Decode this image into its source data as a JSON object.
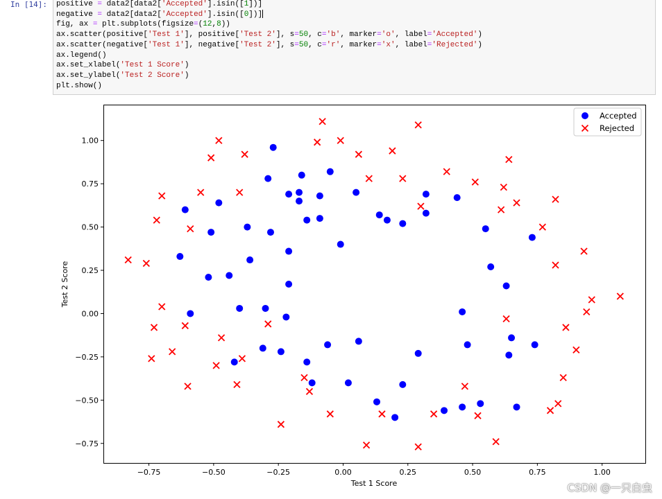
{
  "cell": {
    "prompt": "In  [14]:",
    "lines": [
      [
        [
          "positive ",
          ""
        ],
        [
          "=",
          "op"
        ],
        [
          " data2[data2[",
          ""
        ],
        [
          "'Accepted'",
          "str"
        ],
        [
          "].isin([",
          ""
        ],
        [
          "1",
          "num"
        ],
        [
          "])]",
          ""
        ]
      ],
      [
        [
          "negative ",
          ""
        ],
        [
          "=",
          "op"
        ],
        [
          " data2[data2[",
          ""
        ],
        [
          "'Accepted'",
          "str"
        ],
        [
          "].isin([",
          ""
        ],
        [
          "0",
          "num"
        ],
        [
          "])]",
          ""
        ]
      ],
      [
        [
          "fig, ax ",
          ""
        ],
        [
          "=",
          "op"
        ],
        [
          " plt.subplots(figsize",
          ""
        ],
        [
          "=",
          "op"
        ],
        [
          "(",
          ""
        ],
        [
          "12",
          "num"
        ],
        [
          ",",
          ""
        ],
        [
          "8",
          "num"
        ],
        [
          "))",
          ""
        ]
      ],
      [
        [
          "ax.scatter(positive[",
          ""
        ],
        [
          "'Test 1'",
          "str"
        ],
        [
          "], positive[",
          ""
        ],
        [
          "'Test 2'",
          "str"
        ],
        [
          "], s",
          ""
        ],
        [
          "=",
          "op"
        ],
        [
          "50",
          "num"
        ],
        [
          ", c",
          ""
        ],
        [
          "=",
          "op"
        ],
        [
          "'b'",
          "str"
        ],
        [
          ", marker",
          ""
        ],
        [
          "=",
          "op"
        ],
        [
          "'o'",
          "str"
        ],
        [
          ", label",
          ""
        ],
        [
          "=",
          "op"
        ],
        [
          "'Accepted'",
          "str"
        ],
        [
          ")",
          ""
        ]
      ],
      [
        [
          "ax.scatter(negative[",
          ""
        ],
        [
          "'Test 1'",
          "str"
        ],
        [
          "], negative[",
          ""
        ],
        [
          "'Test 2'",
          "str"
        ],
        [
          "], s",
          ""
        ],
        [
          "=",
          "op"
        ],
        [
          "50",
          "num"
        ],
        [
          ", c",
          ""
        ],
        [
          "=",
          "op"
        ],
        [
          "'r'",
          "str"
        ],
        [
          ", marker",
          ""
        ],
        [
          "=",
          "op"
        ],
        [
          "'x'",
          "str"
        ],
        [
          ", label",
          ""
        ],
        [
          "=",
          "op"
        ],
        [
          "'Rejected'",
          "str"
        ],
        [
          ")",
          ""
        ]
      ],
      [
        [
          "ax.legend()",
          ""
        ]
      ],
      [
        [
          "ax.set_xlabel(",
          ""
        ],
        [
          "'Test 1 Score'",
          "str"
        ],
        [
          ")",
          ""
        ]
      ],
      [
        [
          "ax.set_ylabel(",
          ""
        ],
        [
          "'Test 2 Score'",
          "str"
        ],
        [
          ")",
          ""
        ]
      ],
      [
        [
          "plt.show()",
          ""
        ]
      ]
    ]
  },
  "chart_data": {
    "type": "scatter",
    "xlabel": "Test 1 Score",
    "ylabel": "Test 2 Score",
    "xlim": [
      -0.923,
      1.167
    ],
    "ylim": [
      -0.863,
      1.203
    ],
    "xticks": [
      -0.75,
      -0.5,
      -0.25,
      0.0,
      0.25,
      0.5,
      0.75,
      1.0
    ],
    "xtick_labels": [
      "−0.75",
      "−0.50",
      "−0.25",
      "0.00",
      "0.25",
      "0.50",
      "0.75",
      "1.00"
    ],
    "yticks": [
      -0.75,
      -0.5,
      -0.25,
      0.0,
      0.25,
      0.5,
      0.75,
      1.0
    ],
    "ytick_labels": [
      "−0.75",
      "−0.50",
      "−0.25",
      "0.00",
      "0.25",
      "0.50",
      "0.75",
      "1.00"
    ],
    "grid": false,
    "legend_position": "top-right",
    "series": [
      {
        "name": "Accepted",
        "marker": "o",
        "color": "#0000ff",
        "points": [
          [
            -0.27,
            0.96
          ],
          [
            -0.29,
            0.78
          ],
          [
            -0.16,
            0.8
          ],
          [
            -0.05,
            0.82
          ],
          [
            -0.21,
            0.69
          ],
          [
            -0.17,
            0.7
          ],
          [
            -0.17,
            0.65
          ],
          [
            -0.09,
            0.68
          ],
          [
            0.05,
            0.7
          ],
          [
            0.14,
            0.57
          ],
          [
            -0.48,
            0.64
          ],
          [
            -0.61,
            0.6
          ],
          [
            -0.14,
            0.54
          ],
          [
            -0.09,
            0.55
          ],
          [
            -0.37,
            0.5
          ],
          [
            -0.51,
            0.47
          ],
          [
            -0.28,
            0.47
          ],
          [
            -0.01,
            0.4
          ],
          [
            -0.21,
            0.36
          ],
          [
            -0.36,
            0.31
          ],
          [
            -0.63,
            0.33
          ],
          [
            -0.52,
            0.21
          ],
          [
            -0.44,
            0.22
          ],
          [
            -0.21,
            0.17
          ],
          [
            -0.4,
            0.03
          ],
          [
            -0.3,
            0.03
          ],
          [
            -0.59,
            0.0
          ],
          [
            0.17,
            0.54
          ],
          [
            0.23,
            0.52
          ],
          [
            0.32,
            0.69
          ],
          [
            0.32,
            0.58
          ],
          [
            0.44,
            0.67
          ],
          [
            0.55,
            0.49
          ],
          [
            0.73,
            0.44
          ],
          [
            0.57,
            0.27
          ],
          [
            0.63,
            0.16
          ],
          [
            0.46,
            0.01
          ],
          [
            0.65,
            -0.14
          ],
          [
            0.74,
            -0.18
          ],
          [
            0.64,
            -0.24
          ],
          [
            0.48,
            -0.18
          ],
          [
            0.29,
            -0.23
          ],
          [
            0.06,
            -0.16
          ],
          [
            -0.06,
            -0.18
          ],
          [
            -0.22,
            -0.02
          ],
          [
            -0.31,
            -0.2
          ],
          [
            -0.24,
            -0.22
          ],
          [
            -0.42,
            -0.28
          ],
          [
            -0.14,
            -0.28
          ],
          [
            -0.12,
            -0.4
          ],
          [
            0.02,
            -0.4
          ],
          [
            0.13,
            -0.51
          ],
          [
            0.23,
            -0.41
          ],
          [
            0.2,
            -0.6
          ],
          [
            0.39,
            -0.56
          ],
          [
            0.46,
            -0.54
          ],
          [
            0.53,
            -0.52
          ],
          [
            0.67,
            -0.54
          ]
        ]
      },
      {
        "name": "Rejected",
        "marker": "x",
        "color": "#ff0000",
        "points": [
          [
            -0.08,
            1.11
          ],
          [
            -0.48,
            1.0
          ],
          [
            -0.1,
            0.99
          ],
          [
            -0.01,
            1.0
          ],
          [
            0.06,
            0.92
          ],
          [
            -0.51,
            0.9
          ],
          [
            -0.38,
            0.92
          ],
          [
            0.19,
            0.94
          ],
          [
            0.29,
            1.09
          ],
          [
            0.64,
            0.89
          ],
          [
            0.1,
            0.78
          ],
          [
            0.23,
            0.78
          ],
          [
            0.4,
            0.82
          ],
          [
            0.51,
            0.76
          ],
          [
            0.62,
            0.73
          ],
          [
            0.61,
            0.6
          ],
          [
            0.67,
            0.64
          ],
          [
            -0.55,
            0.7
          ],
          [
            -0.4,
            0.7
          ],
          [
            -0.7,
            0.68
          ],
          [
            -0.72,
            0.54
          ],
          [
            -0.59,
            0.49
          ],
          [
            0.3,
            0.62
          ],
          [
            0.77,
            0.5
          ],
          [
            0.82,
            0.66
          ],
          [
            -0.83,
            0.31
          ],
          [
            -0.76,
            0.29
          ],
          [
            0.93,
            0.36
          ],
          [
            0.82,
            0.28
          ],
          [
            -0.7,
            0.04
          ],
          [
            -0.73,
            -0.08
          ],
          [
            -0.61,
            -0.07
          ],
          [
            -0.29,
            -0.06
          ],
          [
            -0.47,
            -0.14
          ],
          [
            0.63,
            -0.03
          ],
          [
            0.96,
            0.08
          ],
          [
            1.07,
            0.1
          ],
          [
            0.94,
            0.01
          ],
          [
            0.86,
            -0.08
          ],
          [
            -0.74,
            -0.26
          ],
          [
            -0.66,
            -0.22
          ],
          [
            -0.39,
            -0.26
          ],
          [
            -0.49,
            -0.3
          ],
          [
            -0.15,
            -0.37
          ],
          [
            0.47,
            -0.42
          ],
          [
            -0.41,
            -0.41
          ],
          [
            -0.6,
            -0.42
          ],
          [
            -0.13,
            -0.45
          ],
          [
            0.85,
            -0.37
          ],
          [
            0.9,
            -0.21
          ],
          [
            -0.05,
            -0.58
          ],
          [
            0.15,
            -0.58
          ],
          [
            0.35,
            -0.58
          ],
          [
            0.52,
            -0.59
          ],
          [
            0.8,
            -0.56
          ],
          [
            0.83,
            -0.52
          ],
          [
            -0.24,
            -0.64
          ],
          [
            0.09,
            -0.76
          ],
          [
            0.29,
            -0.77
          ],
          [
            0.59,
            -0.74
          ]
        ]
      }
    ]
  },
  "watermark": "CSDN @一只白虫"
}
